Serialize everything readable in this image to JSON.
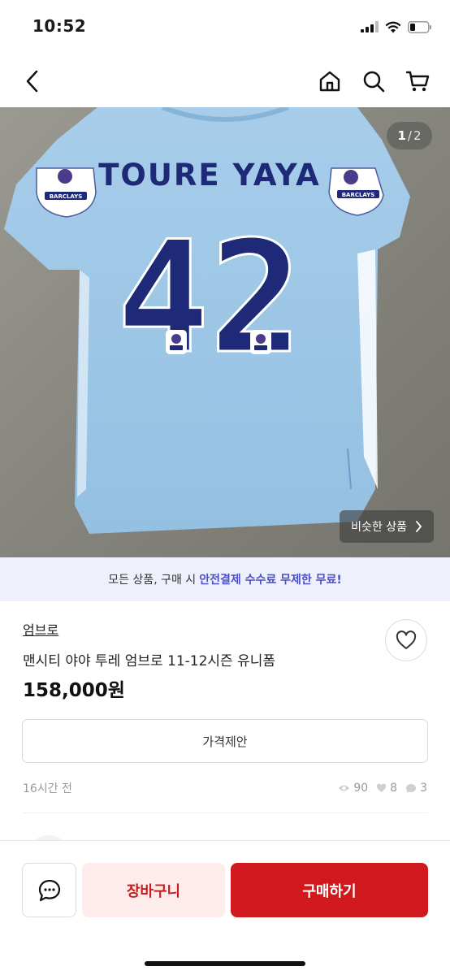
{
  "status_bar": {
    "time": "10:52"
  },
  "image": {
    "current": "1",
    "separator": "/",
    "total": "2",
    "jersey_name": "TOURE YAYA",
    "jersey_number": "42",
    "sponsor": "BARCLAYS",
    "similar_label": "비슷한 상품"
  },
  "promo": {
    "prefix": "모든 상품, 구매 시",
    "highlight": "안전결제 수수료 무제한 무료!"
  },
  "product": {
    "brand": "엄브로",
    "title": "맨시티 야야 투레 엄브로 11-12시즌 유니폼",
    "price": "158,000원"
  },
  "offer_button": "가격제안",
  "meta": {
    "time_ago": "16시간 전",
    "views": "90",
    "likes": "8",
    "chats": "3"
  },
  "bottom_bar": {
    "cart_label": "장바구니",
    "buy_label": "구매하기"
  },
  "colors": {
    "accent": "#d0191c",
    "accent_light": "#fdeceb",
    "promo_bg": "#eef0fb",
    "promo_highlight": "#4b4fc9",
    "jersey": "#9dc6e6",
    "jersey_print": "#1e2a78"
  }
}
